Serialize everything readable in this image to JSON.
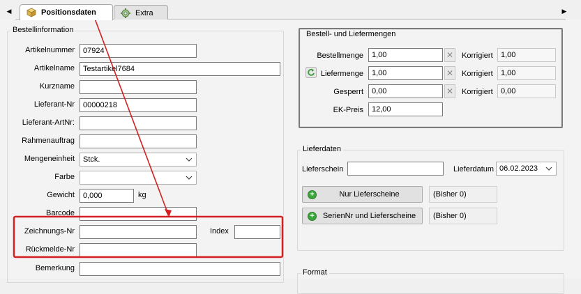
{
  "tabs": [
    {
      "label": "Positionsdaten",
      "icon": "package-icon",
      "active": true
    },
    {
      "label": "Extra",
      "icon": "gear-icon",
      "active": false
    }
  ],
  "bestellinformation": {
    "title": "Bestellinformation",
    "fields": {
      "artikelnummer": {
        "label": "Artikelnummer",
        "value": "07924"
      },
      "artikelname": {
        "label": "Artikelname",
        "value": "Testartikel7684"
      },
      "kurzname": {
        "label": "Kurzname",
        "value": ""
      },
      "lieferant_nr": {
        "label": "Lieferant-Nr",
        "value": "00000218"
      },
      "lieferant_artnr": {
        "label": "Lieferant-ArtNr:",
        "value": ""
      },
      "rahmenauftrag": {
        "label": "Rahmenauftrag",
        "value": ""
      },
      "mengeneinheit": {
        "label": "Mengeneinheit",
        "value": "Stck."
      },
      "farbe": {
        "label": "Farbe",
        "value": ""
      },
      "gewicht": {
        "label": "Gewicht",
        "value": "0,000",
        "unit": "kg"
      },
      "barcode": {
        "label": "Barcode",
        "value": ""
      },
      "zeichnungs_nr": {
        "label": "Zeichnungs-Nr",
        "value": ""
      },
      "index": {
        "label": "Index",
        "value": ""
      },
      "rueckmelde_nr": {
        "label": "Rückmelde-Nr",
        "value": ""
      },
      "bemerkung": {
        "label": "Bemerkung",
        "value": ""
      }
    }
  },
  "mengen": {
    "title": "Bestell- und Liefermengen",
    "rows": {
      "bestellmenge": {
        "label": "Bestellmenge",
        "value": "1,00",
        "korr_label": "Korrigiert",
        "korr_value": "1,00"
      },
      "liefermenge": {
        "label": "Liefermenge",
        "value": "1,00",
        "korr_label": "Korrigiert",
        "korr_value": "1,00"
      },
      "gesperrt": {
        "label": "Gesperrt",
        "value": "0,00",
        "korr_label": "Korrigiert",
        "korr_value": "0,00"
      },
      "ek_preis": {
        "label": "EK-Preis",
        "value": "12,00"
      }
    },
    "clear_symbol": "✕"
  },
  "lieferdaten": {
    "title": "Lieferdaten",
    "lieferschein_label": "Lieferschein",
    "lieferschein_value": "",
    "lieferdatum_label": "Lieferdatum",
    "lieferdatum_value": "06.02.2023",
    "btn_nur": "Nur Lieferscheine",
    "btn_nur_info": "(Bisher 0)",
    "btn_serien": "SerienNr und Lieferscheine",
    "btn_serien_info": "(Bisher 0)"
  },
  "format": {
    "title": "Format"
  },
  "annotation": {
    "color": "#d32020"
  },
  "scroll": {
    "left": "◀",
    "right": "▶"
  }
}
